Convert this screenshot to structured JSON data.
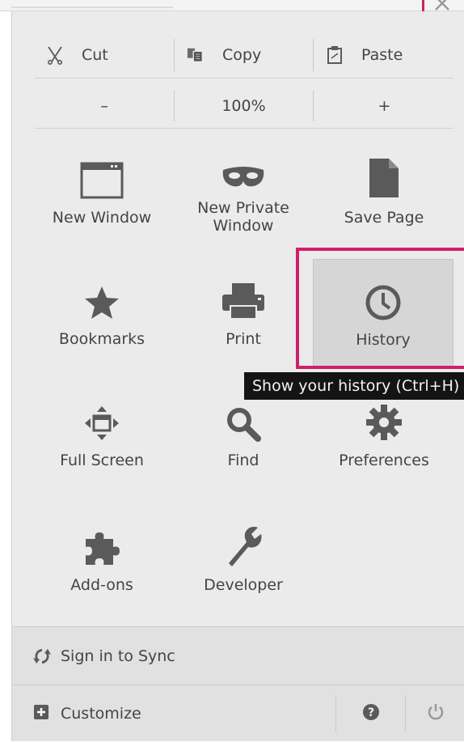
{
  "edit": {
    "cut_label": "Cut",
    "copy_label": "Copy",
    "paste_label": "Paste"
  },
  "zoom": {
    "out_label": "–",
    "level": "100%",
    "in_label": "+"
  },
  "tiles": {
    "new_window": "New Window",
    "new_private_window": "New Private Window",
    "save_page": "Save Page",
    "bookmarks": "Bookmarks",
    "print": "Print",
    "history": "History",
    "full_screen": "Full Screen",
    "find": "Find",
    "preferences": "Preferences",
    "add_ons": "Add-ons",
    "developer": "Developer"
  },
  "tooltip": {
    "text": "Show your history (Ctrl+H)"
  },
  "footer": {
    "sync_label": "Sign in to Sync",
    "customize_label": "Customize"
  },
  "colors": {
    "highlight": "#d0206a",
    "panel_bg": "#ebebeb",
    "icon": "#5a5a5a"
  }
}
